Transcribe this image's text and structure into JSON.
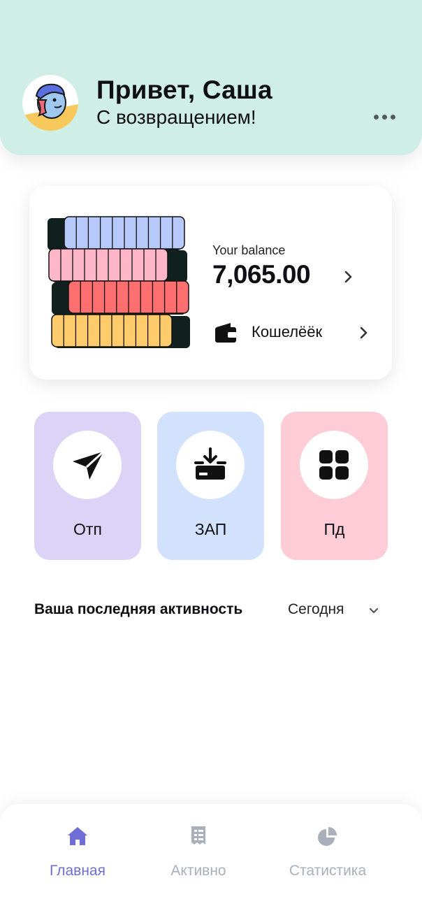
{
  "header": {
    "greeting": "Привет, Саша",
    "subtitle": "С возвращением!",
    "avatar_icon": "user-avatar",
    "more_icon": "more-horizontal-icon"
  },
  "balance": {
    "label": "Your balance",
    "value": "7,065.00",
    "wallet_label": "Кошелёёк",
    "coin_colors": [
      "#b7c8fb",
      "#ffb6c9",
      "#ff6f6f",
      "#ffcb6b"
    ]
  },
  "actions": [
    {
      "label": "Отп",
      "icon": "send-icon",
      "color": "#ddd3f7"
    },
    {
      "label": "ЗАП",
      "icon": "deposit-icon",
      "color": "#d2e2fd"
    },
    {
      "label": "Пд",
      "icon": "grid-icon",
      "color": "#fdccd7"
    }
  ],
  "activity": {
    "title": "Ваша последняя активность",
    "filter": "Сегодня"
  },
  "tabbar": {
    "items": [
      {
        "label": "Главная",
        "icon": "home-icon",
        "active": true
      },
      {
        "label": "Активно",
        "icon": "receipt-icon",
        "active": false
      },
      {
        "label": "Статистика",
        "icon": "pie-chart-icon",
        "active": false
      }
    ],
    "active_color": "#6f6ed6",
    "inactive_color": "#a9b0bb"
  }
}
